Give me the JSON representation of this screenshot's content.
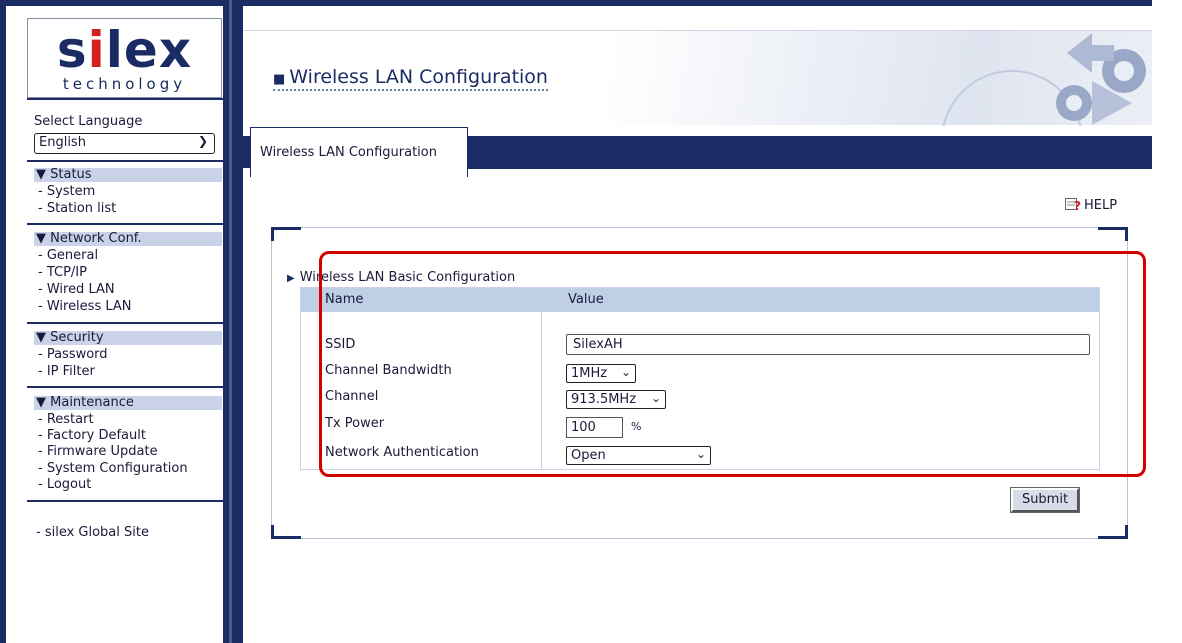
{
  "brand": {
    "logo_pre": "s",
    "logo_i": "i",
    "logo_post": "lex",
    "logo_sub": "technology"
  },
  "sidebar": {
    "language_label": "Select Language",
    "language_value": "English",
    "status": {
      "header": "▼ Status",
      "items": [
        "- System",
        "- Station list"
      ]
    },
    "network": {
      "header": "▼ Network Conf.",
      "items": [
        "- General",
        "- TCP/IP",
        "- Wired LAN",
        "- Wireless LAN"
      ]
    },
    "security": {
      "header": "▼ Security",
      "items": [
        "- Password",
        "- IP Filter"
      ]
    },
    "maintenance": {
      "header": "▼ Maintenance",
      "items": [
        "- Restart",
        "- Factory Default",
        "- Firmware Update",
        "- System Configuration",
        "- Logout"
      ]
    },
    "global_site": "-  silex Global Site"
  },
  "header": {
    "title": "Wireless LAN Configuration"
  },
  "tab": {
    "label": "Wireless LAN Configuration"
  },
  "help_label": "HELP",
  "section": {
    "title": "Wireless LAN Basic Configuration",
    "col_name": "Name",
    "col_value": "Value",
    "ssid_label": "SSID",
    "ssid_value": "SilexAH",
    "bandwidth_label": "Channel Bandwidth",
    "bandwidth_value": "1MHz",
    "channel_label": "Channel",
    "channel_value": "913.5MHz",
    "txpower_label": "Tx Power",
    "txpower_value": "100",
    "txpower_unit": "%",
    "auth_label": "Network Authentication",
    "auth_value": "Open"
  },
  "submit_label": "Submit",
  "colors": {
    "navy": "#1b2b63",
    "header_blue": "#c9d2e6",
    "highlight_red": "#d40000"
  }
}
